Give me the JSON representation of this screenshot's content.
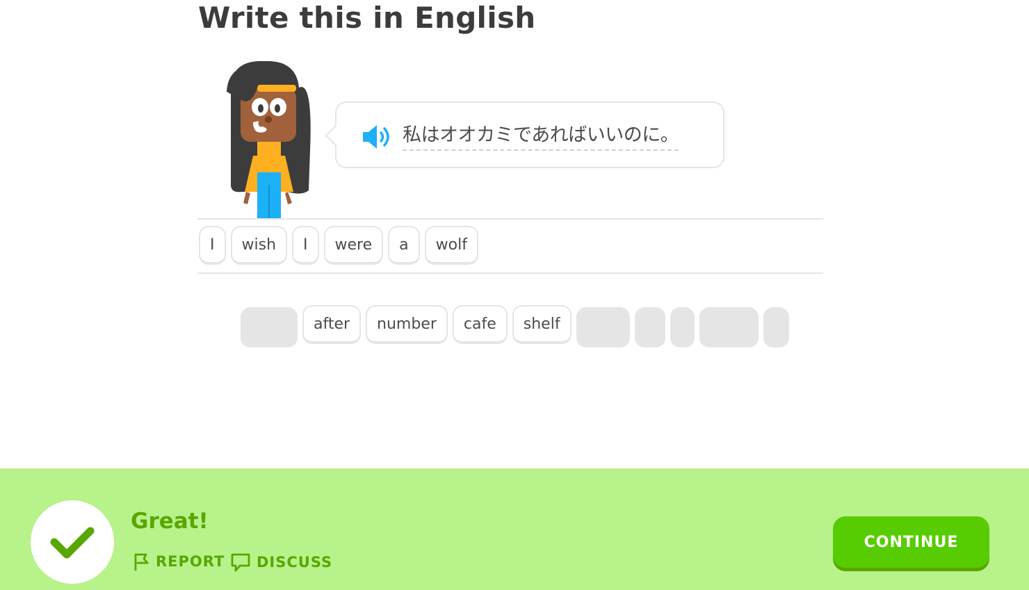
{
  "header": {
    "title": "Write this in English"
  },
  "prompt": {
    "sentence": "私はオオカミであればいいのに。",
    "speaker_icon": "speaker-icon"
  },
  "answer": {
    "tiles": [
      "I",
      "wish",
      "I",
      "were",
      "a",
      "wolf"
    ]
  },
  "word_bank": {
    "tiles": [
      "after",
      "number",
      "cafe",
      "shelf"
    ]
  },
  "feedback": {
    "message": "Great!",
    "report_label": "REPORT",
    "discuss_label": "DISCUSS",
    "continue_label": "CONTINUE"
  },
  "colors": {
    "footer_bg": "#b8f28b",
    "success_text": "#58a700",
    "button": "#58cc02",
    "speaker": "#1cb0f6"
  }
}
